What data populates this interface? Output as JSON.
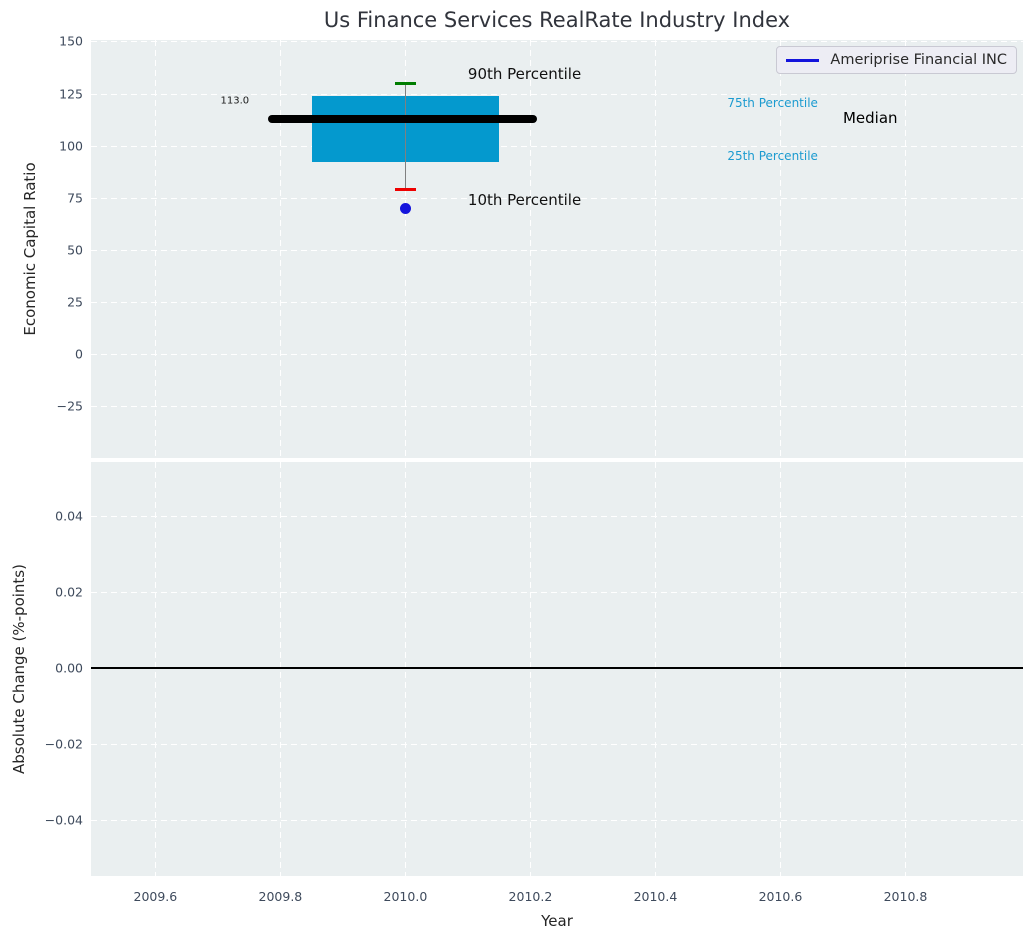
{
  "title": "Us Finance Services RealRate Industry Index",
  "legend": {
    "label": "Ameriprise Financial INC",
    "line_color": "#1414dc"
  },
  "chart_data": [
    {
      "type": "box",
      "title": "Us Finance Services RealRate Industry Index",
      "ylabel": "Economic Capital Ratio",
      "xlim": [
        2009.497,
        2010.988
      ],
      "ylim": [
        -49.9,
        150.7
      ],
      "grid": true,
      "show_xtick_labels": false,
      "xticks": [
        {
          "v": 2009.6,
          "label": "2009.6"
        },
        {
          "v": 2009.8,
          "label": "2009.8"
        },
        {
          "v": 2010.0,
          "label": "2010.0"
        },
        {
          "v": 2010.2,
          "label": "2010.2"
        },
        {
          "v": 2010.4,
          "label": "2010.4"
        },
        {
          "v": 2010.6,
          "label": "2010.6"
        },
        {
          "v": 2010.8,
          "label": "2010.8"
        }
      ],
      "yticks": [
        {
          "v": 150,
          "label": "150"
        },
        {
          "v": 125,
          "label": "125"
        },
        {
          "v": 100,
          "label": "100"
        },
        {
          "v": 75,
          "label": "75"
        },
        {
          "v": 50,
          "label": "50"
        },
        {
          "v": 25,
          "label": "25"
        },
        {
          "v": 0,
          "label": "0"
        },
        {
          "v": -25,
          "label": "−25"
        }
      ],
      "box": {
        "x_center": 2010.0,
        "box_left": 2009.85,
        "box_right": 2010.15,
        "p90": 130,
        "p75": 124,
        "median": 113.0,
        "p25": 92,
        "p10": 79,
        "median_label": "113.0",
        "median_line_left": 2009.78,
        "median_line_right": 2010.21,
        "box_color": "#0499ce",
        "median_color": "#000000",
        "p90_cap_color": "#007d00",
        "p10_cap_color": "#ee0000",
        "whisker_color": "#808080"
      },
      "company_point": {
        "name": "Ameriprise Financial INC",
        "x": 2010.0,
        "value": 70,
        "color": "#1414dc"
      },
      "legend_position": "upper right",
      "annotations": [
        {
          "text": "90th Percentile",
          "x": 2010.1,
          "y": 134.4,
          "ha": "left",
          "color": "#111111",
          "size": 15
        },
        {
          "text": "10th Percentile",
          "x": 2010.1,
          "y": 73.9,
          "ha": "left",
          "color": "#111111",
          "size": 15
        },
        {
          "text": "75th Percentile",
          "x": 2010.515,
          "y": 120.4,
          "ha": "left",
          "color": "#1c9bd0",
          "size": 12
        },
        {
          "text": "25th Percentile",
          "x": 2010.515,
          "y": 95.0,
          "ha": "left",
          "color": "#1c9bd0",
          "size": 12
        },
        {
          "text": "Median",
          "x": 2010.7,
          "y": 113.3,
          "ha": "left",
          "color": "#000000",
          "size": 15
        },
        {
          "text": "113.0",
          "x": 2009.75,
          "y": 121.5,
          "ha": "right",
          "color": "#1a1a1a",
          "size": 10
        }
      ]
    },
    {
      "type": "line",
      "ylabel": "Absolute Change (%-points)",
      "xlabel": "Year",
      "xlim": [
        2009.497,
        2010.988
      ],
      "ylim": [
        -0.0547,
        0.0542
      ],
      "grid": true,
      "show_xtick_labels": true,
      "xticks": [
        {
          "v": 2009.6,
          "label": "2009.6"
        },
        {
          "v": 2009.8,
          "label": "2009.8"
        },
        {
          "v": 2010.0,
          "label": "2010.0"
        },
        {
          "v": 2010.2,
          "label": "2010.2"
        },
        {
          "v": 2010.4,
          "label": "2010.4"
        },
        {
          "v": 2010.6,
          "label": "2010.6"
        },
        {
          "v": 2010.8,
          "label": "2010.8"
        }
      ],
      "yticks": [
        {
          "v": 0.04,
          "label": "0.04"
        },
        {
          "v": 0.02,
          "label": "0.02"
        },
        {
          "v": 0.0,
          "label": "0.00"
        },
        {
          "v": -0.02,
          "label": "−0.02"
        },
        {
          "v": -0.04,
          "label": "−0.04"
        }
      ],
      "zero_line": {
        "value": 0.0,
        "color": "#000000"
      }
    }
  ]
}
